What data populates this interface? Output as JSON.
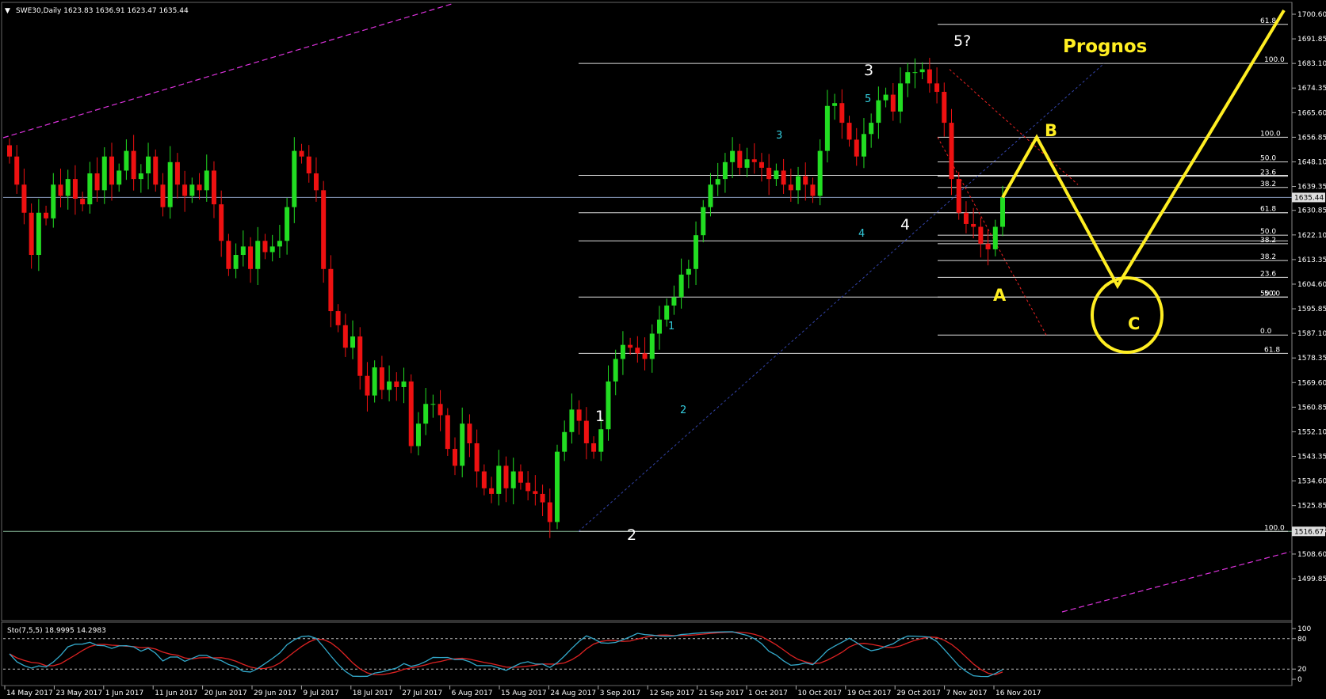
{
  "symbol_header": "SWE30,Daily  1623.83 1636.91 1623.47 1635.44",
  "indicator_header": "Sto(7,5,5) 18.9995 14.2983",
  "annotations": {
    "prognos": "Prognos",
    "wave_white": [
      "1",
      "2",
      "3",
      "4",
      "5?"
    ],
    "wave_cyan": [
      "1",
      "2",
      "3",
      "4",
      "5"
    ],
    "abc": [
      "A",
      "B",
      "C"
    ]
  },
  "colors": {
    "background": "#000000",
    "bull": "#22dd22",
    "bear": "#ee1111",
    "forecast": "#ffee22",
    "channel": "#dd33dd",
    "stoch_main": "#33aacc",
    "stoch_signal": "#dd2222"
  },
  "chart_data": [
    {
      "type": "candlestick",
      "title": "SWE30,Daily",
      "ohlc_last": {
        "open": 1623.83,
        "high": 1636.91,
        "low": 1623.47,
        "close": 1635.44
      },
      "y_ticks": [
        "1700.60",
        "1691.85",
        "1683.10",
        "1674.35",
        "1665.60",
        "1656.85",
        "1648.10",
        "1639.35",
        "1630.85",
        "1622.10",
        "1613.35",
        "1604.60",
        "1595.85",
        "1587.10",
        "1578.35",
        "1569.60",
        "1560.85",
        "1552.10",
        "1543.35",
        "1534.60",
        "1525.85",
        "1517.10",
        "1508.60",
        "1499.85"
      ],
      "price_labels": [
        "1635.44",
        "1516.67"
      ],
      "ylim": [
        1499.85,
        1700.6
      ],
      "x_ticks": [
        "14 May 2017",
        "23 May 2017",
        "1 Jun 2017",
        "11 Jun 2017",
        "20 Jun 2017",
        "29 Jun 2017",
        "9 Jul 2017",
        "18 Jul 2017",
        "27 Jul 2017",
        "6 Aug 2017",
        "15 Aug 2017",
        "24 Aug 2017",
        "3 Sep 2017",
        "12 Sep 2017",
        "21 Sep 2017",
        "1 Oct 2017",
        "10 Oct 2017",
        "19 Oct 2017",
        "29 Oct 2017",
        "7 Nov 2017",
        "16 Nov 2017"
      ],
      "closes": [
        1650,
        1640,
        1630,
        1615,
        1630,
        1628,
        1640,
        1636,
        1642,
        1635,
        1633,
        1644,
        1638,
        1650,
        1640,
        1645,
        1652,
        1642,
        1644,
        1650,
        1640,
        1632,
        1648,
        1640,
        1636,
        1640,
        1638,
        1645,
        1633,
        1620,
        1610,
        1615,
        1618,
        1610,
        1620,
        1616,
        1618,
        1620,
        1632,
        1652,
        1650,
        1644,
        1638,
        1610,
        1595,
        1590,
        1582,
        1586,
        1572,
        1565,
        1575,
        1567,
        1570,
        1568,
        1570,
        1547,
        1555,
        1562,
        1562,
        1558,
        1546,
        1540,
        1555,
        1548,
        1538,
        1532,
        1530,
        1540,
        1532,
        1538,
        1534,
        1531,
        1530,
        1527,
        1520,
        1545,
        1552,
        1560,
        1556,
        1548,
        1545,
        1553,
        1570,
        1578,
        1583,
        1582,
        1580,
        1578,
        1587,
        1592,
        1597,
        1600,
        1608,
        1610,
        1622,
        1632,
        1640,
        1642,
        1648,
        1652,
        1646,
        1649,
        1648,
        1646,
        1642,
        1645,
        1640,
        1638,
        1643,
        1640,
        1636,
        1652,
        1668,
        1669,
        1662,
        1656,
        1650,
        1658,
        1662,
        1670,
        1672,
        1666,
        1676,
        1680,
        1680,
        1681,
        1676,
        1673,
        1662,
        1642,
        1630,
        1626,
        1625,
        1619,
        1617,
        1625,
        1635.44
      ],
      "fib_levels_primary": [
        "100.0",
        "61.8",
        "50.0",
        "38.2",
        "0.0",
        "61.8",
        "100.0"
      ],
      "fib_levels_secondary": [
        "61.8",
        "100.0",
        "50.0",
        "23.6",
        "38.2",
        "61.8",
        "50.0",
        "38.2",
        "38.2",
        "23.6",
        "50.0",
        "0.0"
      ]
    },
    {
      "type": "line",
      "title": "Sto(7,5,5)",
      "values": {
        "main": 18.9995,
        "signal": 14.2983
      },
      "levels": [
        80,
        20
      ],
      "y_ticks": [
        "100",
        "80",
        "20",
        "0"
      ]
    }
  ]
}
